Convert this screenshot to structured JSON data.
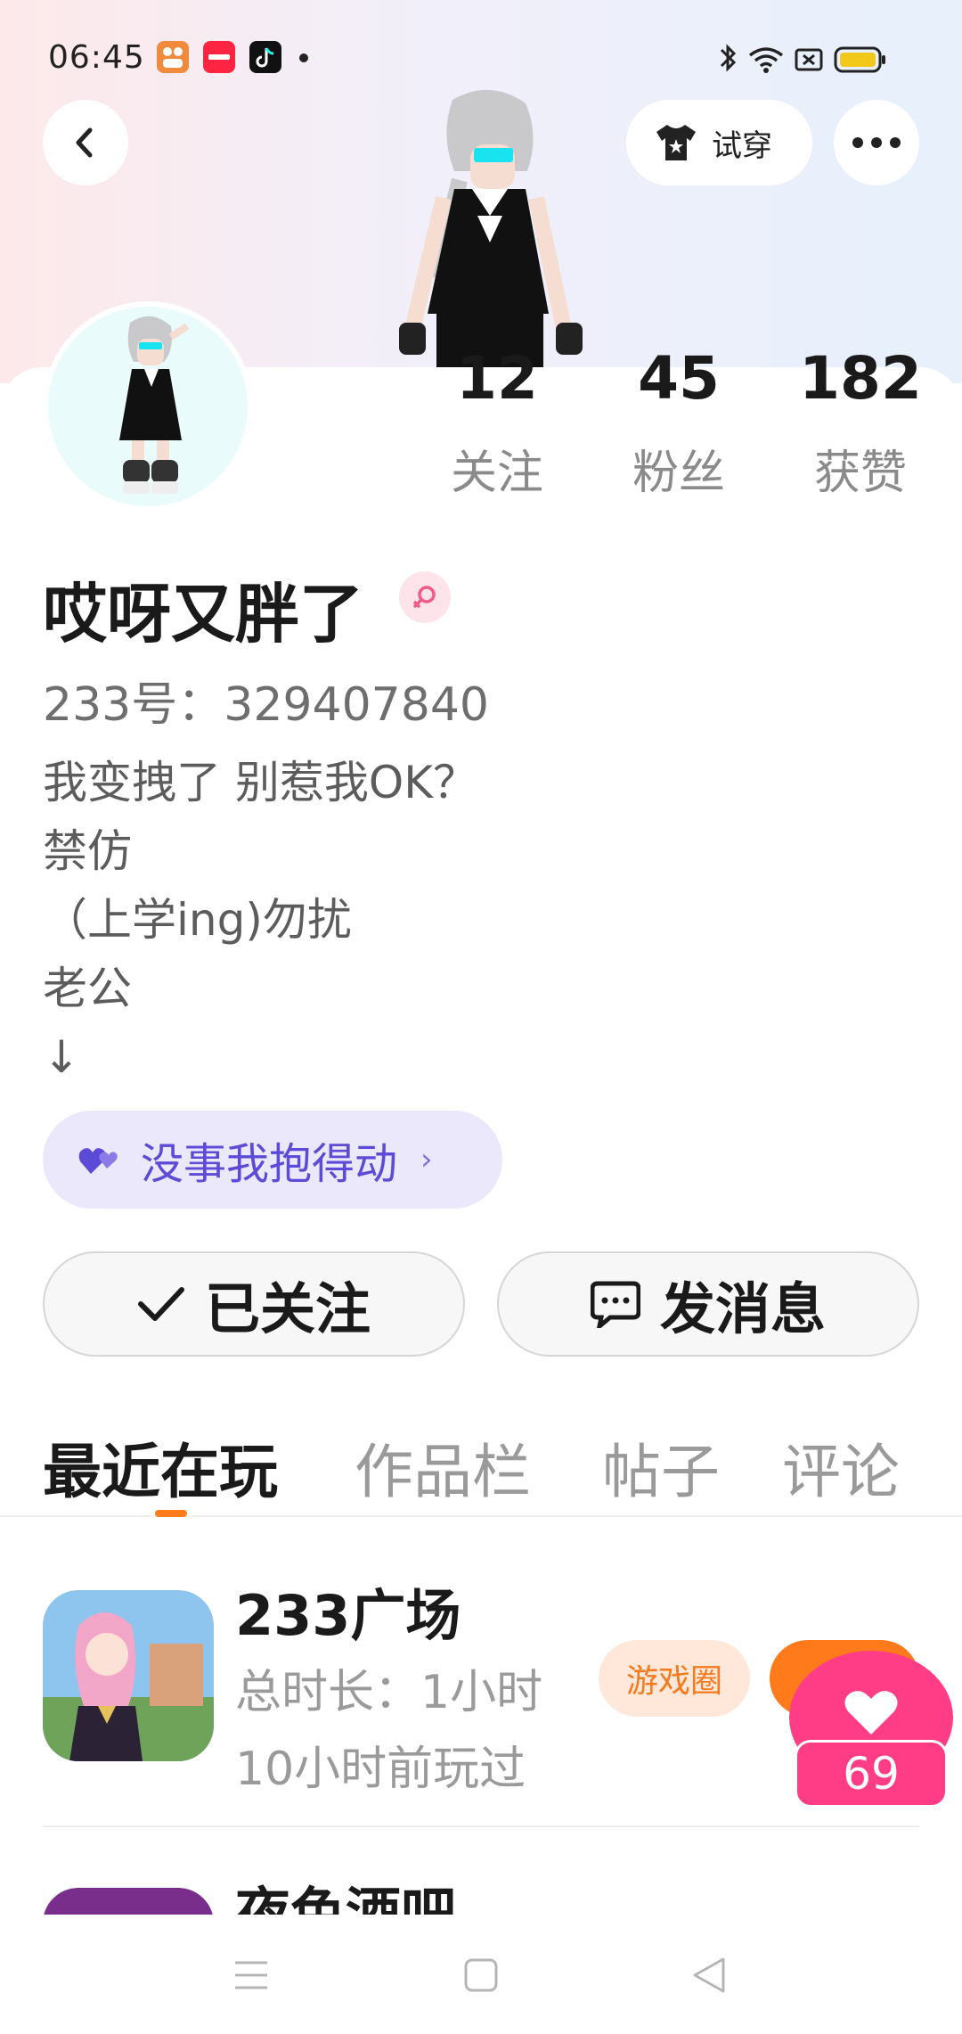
{
  "status_bar": {
    "time": "06:45",
    "apps": [
      {
        "name": "app-notification-icon",
        "color": "#f08a3c"
      },
      {
        "name": "xiaohongshu-icon",
        "color": "#ff2442",
        "text": "小红书"
      },
      {
        "name": "tiktok-icon",
        "color": "#111111"
      }
    ]
  },
  "header": {
    "tryon_label": "试穿"
  },
  "profile": {
    "stats": [
      {
        "value": "12",
        "label": "关注"
      },
      {
        "value": "45",
        "label": "粉丝"
      },
      {
        "value": "182",
        "label": "获赞"
      }
    ],
    "username": "哎呀又胖了",
    "uid": "233号：329407840",
    "bio_lines": [
      "我变拽了 别惹我OK？",
      "禁仿",
      "（上学ing)勿扰",
      "老公",
      "↓"
    ],
    "tag": "没事我抱得动"
  },
  "actions": {
    "follow_label": "已关注",
    "message_label": "发消息"
  },
  "tabs": [
    "最近在玩",
    "作品栏",
    "帖子",
    "评论"
  ],
  "games": [
    {
      "title": "233广场",
      "duration": "总时长：1小时",
      "last_played": "10小时前玩过",
      "circle_label": "游戏圈"
    },
    {
      "title": "夜色酒吧"
    }
  ],
  "like_badge": {
    "count": "69"
  },
  "colors": {
    "accent": "#ff7a1a",
    "tag_purple": "#5c4bd6",
    "like_pink": "#ff3d87"
  }
}
